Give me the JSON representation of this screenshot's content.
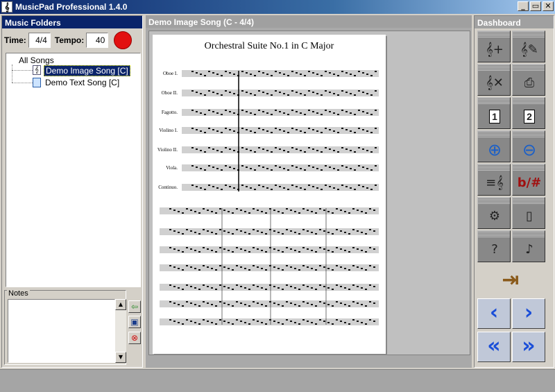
{
  "window": {
    "title": "MusicPad Professional 1.4.0",
    "buttons": [
      "_",
      "▭",
      "✕"
    ]
  },
  "left": {
    "header": "Music Folders",
    "time_label": "Time:",
    "time_value": "4/4",
    "tempo_label": "Tempo:",
    "tempo_value": "40",
    "tree": {
      "root": "All Songs",
      "items": [
        {
          "label": "Demo Image Song [C]",
          "selected": true,
          "icon": "clef-icon"
        },
        {
          "label": "Demo Text Song [C]",
          "selected": false,
          "icon": "document-icon"
        }
      ]
    },
    "notes_label": "Notes",
    "accent_record": "#e21010"
  },
  "center": {
    "header": "Demo Image Song (C - 4/4)",
    "sheet_title": "Orchestral Suite No.1 in C Major",
    "staff_labels": [
      "Oboe I.",
      "Oboe II.",
      "Fagotto.",
      "Violino I.",
      "Violino II.",
      "Viola.",
      "Continuo."
    ]
  },
  "right": {
    "header": "Dashboard",
    "tiles": [
      {
        "name": "new-song-icon",
        "glyph": "𝄞+"
      },
      {
        "name": "edit-song-icon",
        "glyph": "𝄞✎"
      },
      {
        "name": "delete-song-icon",
        "glyph": "𝄞✕"
      },
      {
        "name": "print-icon",
        "glyph": "⎙"
      },
      {
        "name": "page-one-icon",
        "glyph": "1"
      },
      {
        "name": "page-two-icon",
        "glyph": "2"
      },
      {
        "name": "zoom-in-icon",
        "glyph": "⊕"
      },
      {
        "name": "zoom-out-icon",
        "glyph": "⊖"
      },
      {
        "name": "text-notation-icon",
        "glyph": "≡𝄞"
      },
      {
        "name": "transpose-icon",
        "glyph": "b/#"
      },
      {
        "name": "settings-icon",
        "glyph": "⚙"
      },
      {
        "name": "device-icon",
        "glyph": "▯"
      },
      {
        "name": "help-icon",
        "glyph": "?"
      },
      {
        "name": "metronome-icon",
        "glyph": "♪"
      }
    ],
    "exit_glyph": "⇥",
    "nav": [
      "‹",
      "›",
      "«",
      "»"
    ]
  }
}
